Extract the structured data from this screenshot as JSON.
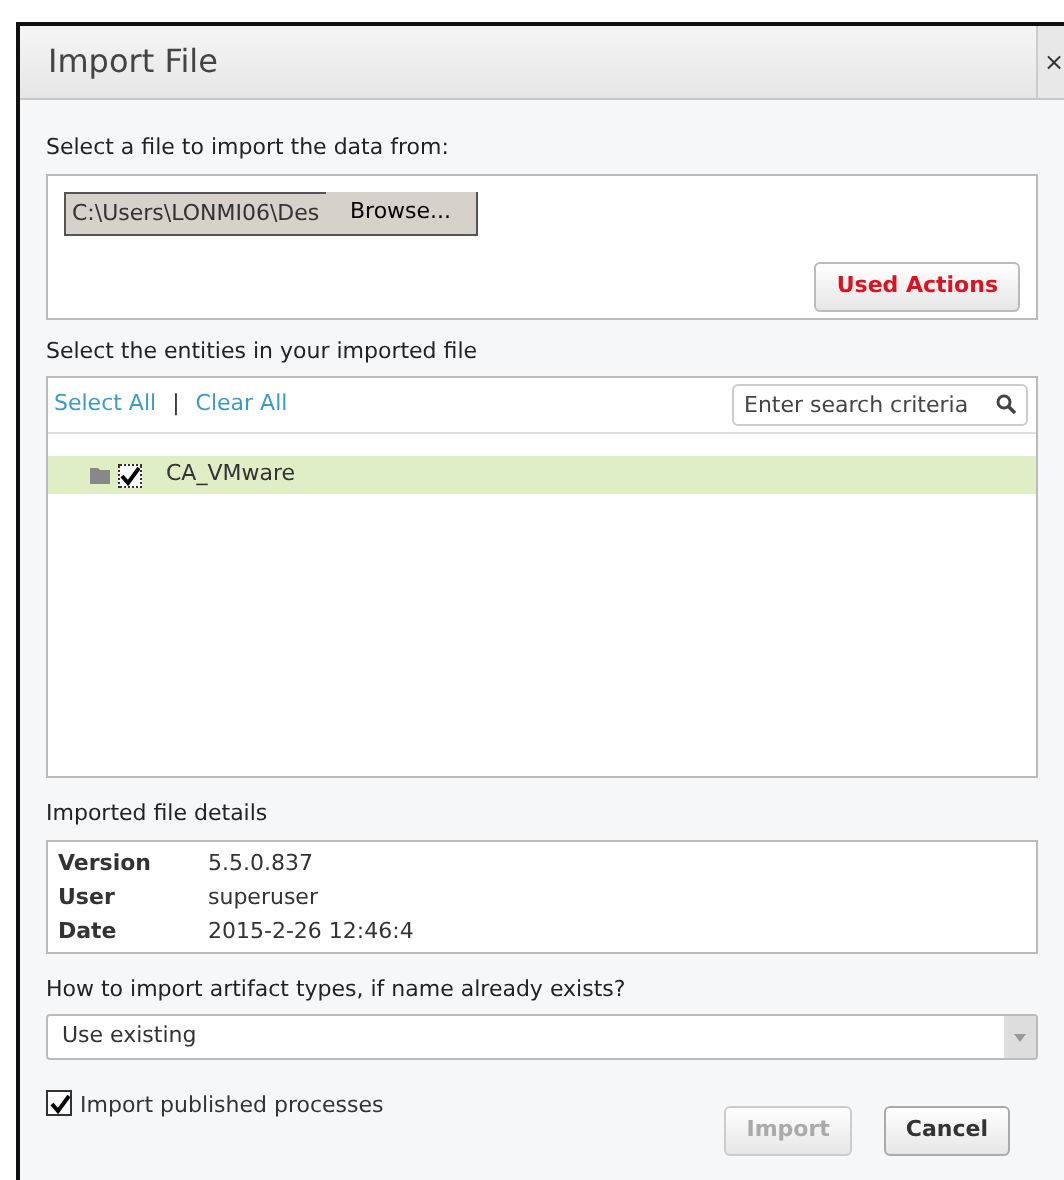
{
  "window": {
    "title": "Import File",
    "close": "×"
  },
  "file_section": {
    "label": "Select a file to import the data from:",
    "path": "C:\\Users\\LONMI06\\Des",
    "browse": "Browse...",
    "used_actions": "Used Actions"
  },
  "entities": {
    "label": "Select the entities in your imported file",
    "select_all": "Select All",
    "separator": "|",
    "clear_all": "Clear All",
    "search": {
      "placeholder": "Enter search criteria"
    },
    "items": [
      {
        "name": "CA_VMware",
        "checked": true,
        "selected": true
      }
    ]
  },
  "details": {
    "label": "Imported file details",
    "rows": [
      {
        "key": "Version",
        "value": "5.5.0.837"
      },
      {
        "key": "User",
        "value": "superuser"
      },
      {
        "key": "Date",
        "value": "2015-2-26 12:46:4"
      }
    ]
  },
  "artifact": {
    "label": "How to import artifact types, if name already exists?",
    "value": "Use existing"
  },
  "publish": {
    "label": "Import published processes",
    "checked": true
  },
  "buttons": [
    {
      "label": "Import",
      "disabled": true
    },
    {
      "label": "Cancel",
      "disabled": false
    }
  ]
}
